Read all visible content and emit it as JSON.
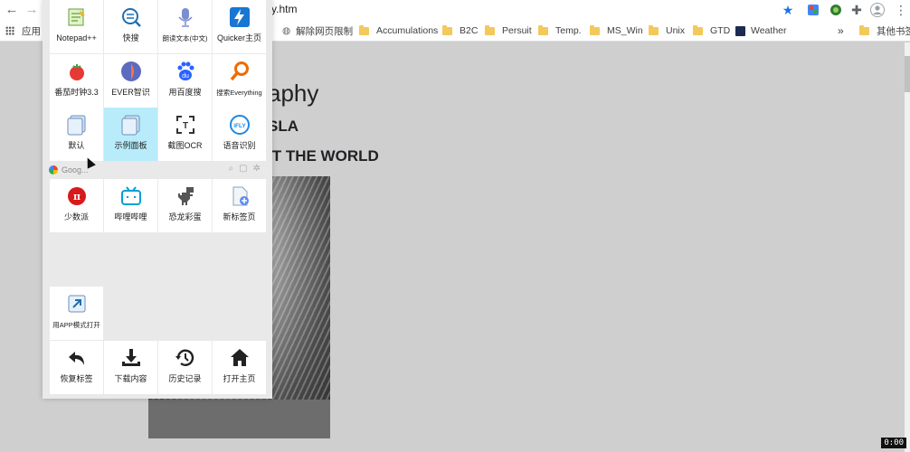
{
  "browser": {
    "url_fragment": "y.htm",
    "icons": {
      "back": "back-arrow-icon",
      "forward": "forward-arrow-icon",
      "bookmark_star": "star-icon",
      "extensions": "puzzle-icon",
      "profile": "profile-icon",
      "menu": "kebab-menu-icon"
    },
    "bookmarks": {
      "apps": "应用",
      "unblock": "解除网页限制",
      "items": [
        "Accumulations",
        "B2C",
        "Persuit",
        "Temp.",
        "MS_Win",
        "Unix",
        "GTD"
      ],
      "weather": "Weather",
      "more": "»",
      "other": "其他书签"
    }
  },
  "page": {
    "title": "aphy",
    "heading2": "SLA",
    "heading3": "IT THE WORLD"
  },
  "panel": {
    "tiles_top": [
      {
        "label": "Notepad++",
        "icon": "notepad-icon"
      },
      {
        "label": "快搜",
        "icon": "quick-search-icon"
      },
      {
        "label": "朗读文本(中文)",
        "icon": "microphone-icon"
      },
      {
        "label": "Quicker主页",
        "icon": "quicker-bolt-icon"
      },
      {
        "label": "番茄时钟3.3",
        "icon": "tomato-icon"
      },
      {
        "label": "EVER智识",
        "icon": "ever-icon"
      },
      {
        "label": "用百度搜",
        "icon": "baidu-paw-icon"
      },
      {
        "label": "搜索Everything",
        "icon": "magnifier-icon"
      },
      {
        "label": "默认",
        "icon": "default-panel-icon"
      },
      {
        "label": "示例面板",
        "icon": "sample-panel-icon"
      },
      {
        "label": "截图OCR",
        "icon": "ocr-icon"
      },
      {
        "label": "语音识别",
        "icon": "ifly-icon"
      }
    ],
    "search_placeholder": "Goog...",
    "tiles_context": [
      {
        "label": "少数派",
        "icon": "sspai-icon"
      },
      {
        "label": "哔哩哔哩",
        "icon": "bilibili-icon"
      },
      {
        "label": "恐龙彩蛋",
        "icon": "dino-icon"
      },
      {
        "label": "新标签页",
        "icon": "new-tab-icon"
      }
    ],
    "open_as_app": {
      "label": "用APP模式打开",
      "icon": "open-app-icon"
    },
    "tiles_bottom": [
      {
        "label": "恢复标签",
        "icon": "restore-icon"
      },
      {
        "label": "下载内容",
        "icon": "download-icon"
      },
      {
        "label": "历史记录",
        "icon": "history-icon"
      },
      {
        "label": "打开主页",
        "icon": "home-icon"
      }
    ]
  },
  "timer": "0:00"
}
